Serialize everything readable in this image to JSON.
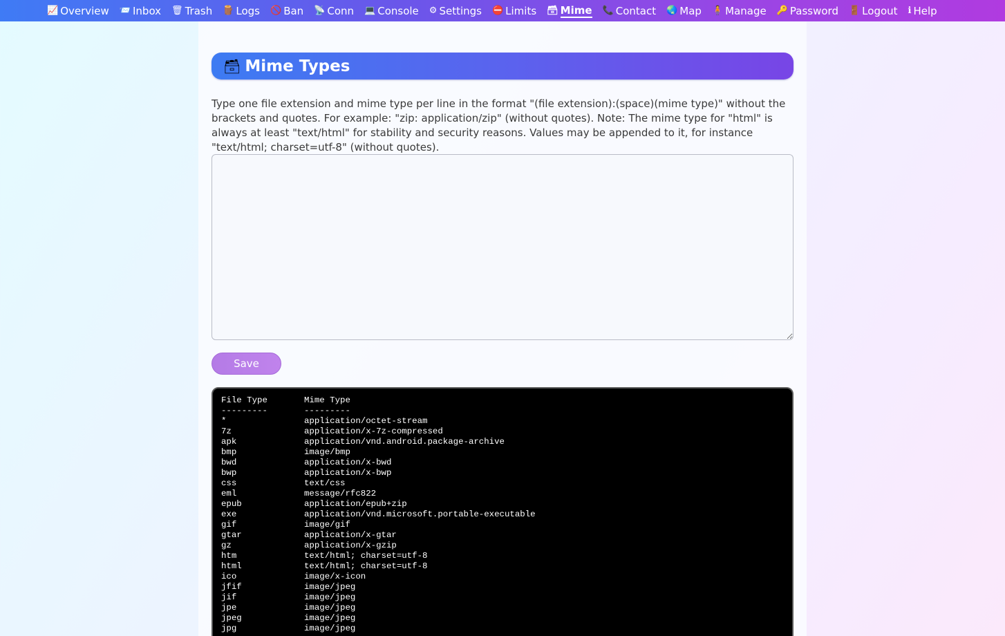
{
  "nav": [
    {
      "label": "Overview",
      "icon": "📈",
      "name": "overview"
    },
    {
      "label": "Inbox",
      "icon": "📨",
      "name": "inbox"
    },
    {
      "label": "Trash",
      "icon": "🗑",
      "name": "trash"
    },
    {
      "label": "Logs",
      "icon": "🪵",
      "name": "logs"
    },
    {
      "label": "Ban",
      "icon": "🚫",
      "name": "ban"
    },
    {
      "label": "Conn",
      "icon": "📡",
      "name": "conn"
    },
    {
      "label": "Console",
      "icon": "💻",
      "name": "console"
    },
    {
      "label": "Settings",
      "icon": "⚙",
      "name": "settings"
    },
    {
      "label": "Limits",
      "icon": "⛔",
      "name": "limits"
    },
    {
      "label": "Mime",
      "icon": "🗃",
      "name": "mime",
      "active": true
    },
    {
      "label": "Contact",
      "icon": "📞",
      "name": "contact"
    },
    {
      "label": "Map",
      "icon": "🌏",
      "name": "map"
    },
    {
      "label": "Manage",
      "icon": "🧍",
      "name": "manage"
    },
    {
      "label": "Password",
      "icon": "🔑",
      "name": "password"
    },
    {
      "label": "Logout",
      "icon": "🚪",
      "name": "logout"
    },
    {
      "label": "Help",
      "icon": "ℹ",
      "name": "help"
    }
  ],
  "header": {
    "icon": "🗃",
    "title": "Mime Types"
  },
  "description": "Type one file extension and mime type per line in the format \"(file extension):(space)(mime type)\" without the brackets and quotes. For example: \"zip: application/zip\" (without quotes). Note: The mime type for \"html\" is always at least \"text/html\" for stability and security reasons. Values may be appended to it, for instance \"text/html; charset=utf-8\" (without quotes).",
  "editor": {
    "value": ""
  },
  "save_label": "Save",
  "table": {
    "headers": [
      "File Type",
      "Mime Type"
    ],
    "separator": [
      "---------",
      "---------"
    ],
    "rows": [
      [
        "*",
        "application/octet-stream"
      ],
      [
        "7z",
        "application/x-7z-compressed"
      ],
      [
        "apk",
        "application/vnd.android.package-archive"
      ],
      [
        "bmp",
        "image/bmp"
      ],
      [
        "bwd",
        "application/x-bwd"
      ],
      [
        "bwp",
        "application/x-bwp"
      ],
      [
        "css",
        "text/css"
      ],
      [
        "eml",
        "message/rfc822"
      ],
      [
        "epub",
        "application/epub+zip"
      ],
      [
        "exe",
        "application/vnd.microsoft.portable-executable"
      ],
      [
        "gif",
        "image/gif"
      ],
      [
        "gtar",
        "application/x-gtar"
      ],
      [
        "gz",
        "application/x-gzip"
      ],
      [
        "htm",
        "text/html; charset=utf-8"
      ],
      [
        "html",
        "text/html; charset=utf-8"
      ],
      [
        "ico",
        "image/x-icon"
      ],
      [
        "jfif",
        "image/jpeg"
      ],
      [
        "jif",
        "image/jpeg"
      ],
      [
        "jpe",
        "image/jpeg"
      ],
      [
        "jpeg",
        "image/jpeg"
      ],
      [
        "jpg",
        "image/jpeg"
      ]
    ]
  }
}
